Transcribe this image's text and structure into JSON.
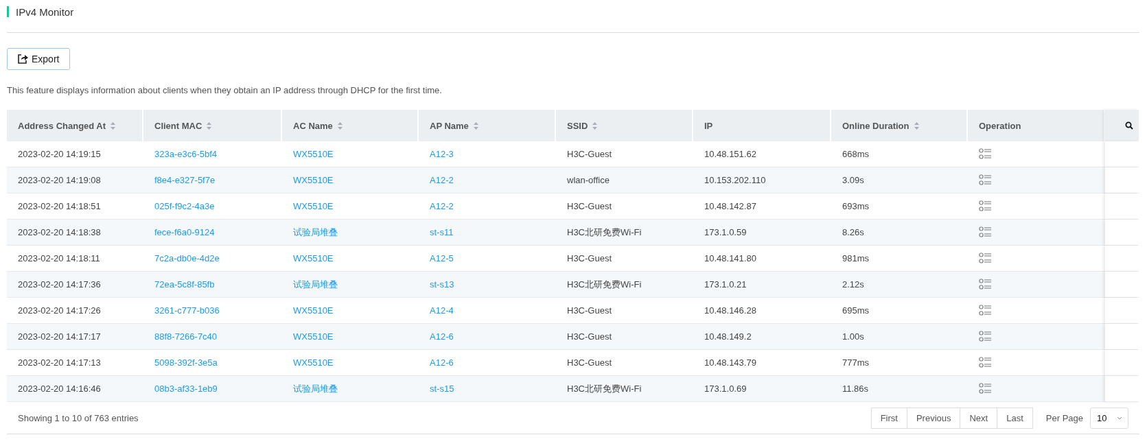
{
  "page_title": "IPv4 Monitor",
  "export_button": "Export",
  "description": "This feature displays information about clients when they obtain an IP address through DHCP for the first time.",
  "table": {
    "columns": [
      {
        "label": "Address Changed At",
        "sortable": true
      },
      {
        "label": "Client MAC",
        "sortable": true
      },
      {
        "label": "AC Name",
        "sortable": true
      },
      {
        "label": "AP Name",
        "sortable": true
      },
      {
        "label": "SSID",
        "sortable": true
      },
      {
        "label": "IP",
        "sortable": false
      },
      {
        "label": "Online Duration",
        "sortable": true
      },
      {
        "label": "Operation",
        "sortable": false
      }
    ],
    "rows": [
      {
        "time": "2023-02-20 14:19:15",
        "mac": "323a-e3c6-5bf4",
        "ac": "WX5510E",
        "ap": "A12-3",
        "ssid": "H3C-Guest",
        "ip": "10.48.151.62",
        "duration": "668ms"
      },
      {
        "time": "2023-02-20 14:19:08",
        "mac": "f8e4-e327-5f7e",
        "ac": "WX5510E",
        "ap": "A12-2",
        "ssid": "wlan-office",
        "ip": "10.153.202.110",
        "duration": "3.09s"
      },
      {
        "time": "2023-02-20 14:18:51",
        "mac": "025f-f9c2-4a3e",
        "ac": "WX5510E",
        "ap": "A12-2",
        "ssid": "H3C-Guest",
        "ip": "10.48.142.87",
        "duration": "693ms"
      },
      {
        "time": "2023-02-20 14:18:38",
        "mac": "fece-f6a0-9124",
        "ac": "试验局堆叠",
        "ap": "st-s11",
        "ssid": "H3C北研免费Wi-Fi",
        "ip": "173.1.0.59",
        "duration": "8.26s"
      },
      {
        "time": "2023-02-20 14:18:11",
        "mac": "7c2a-db0e-4d2e",
        "ac": "WX5510E",
        "ap": "A12-5",
        "ssid": "H3C-Guest",
        "ip": "10.48.141.80",
        "duration": "981ms"
      },
      {
        "time": "2023-02-20 14:17:36",
        "mac": "72ea-5c8f-85fb",
        "ac": "试验局堆叠",
        "ap": "st-s13",
        "ssid": "H3C北研免费Wi-Fi",
        "ip": "173.1.0.21",
        "duration": "2.12s"
      },
      {
        "time": "2023-02-20 14:17:26",
        "mac": "3261-c777-b036",
        "ac": "WX5510E",
        "ap": "A12-4",
        "ssid": "H3C-Guest",
        "ip": "10.48.146.28",
        "duration": "695ms"
      },
      {
        "time": "2023-02-20 14:17:17",
        "mac": "88f8-7266-7c40",
        "ac": "WX5510E",
        "ap": "A12-6",
        "ssid": "H3C-Guest",
        "ip": "10.48.149.2",
        "duration": "1.00s"
      },
      {
        "time": "2023-02-20 14:17:13",
        "mac": "5098-392f-3e5a",
        "ac": "WX5510E",
        "ap": "A12-6",
        "ssid": "H3C-Guest",
        "ip": "10.48.143.79",
        "duration": "777ms"
      },
      {
        "time": "2023-02-20 14:16:46",
        "mac": "08b3-af33-1eb9",
        "ac": "试验局堆叠",
        "ap": "st-s15",
        "ssid": "H3C北研免费Wi-Fi",
        "ip": "173.1.0.69",
        "duration": "11.86s"
      }
    ]
  },
  "footer": {
    "summary": "Showing 1 to 10 of 763 entries",
    "pager": [
      "First",
      "Previous",
      "Next",
      "Last"
    ],
    "per_page_label": "Per Page",
    "per_page_value": "10"
  }
}
